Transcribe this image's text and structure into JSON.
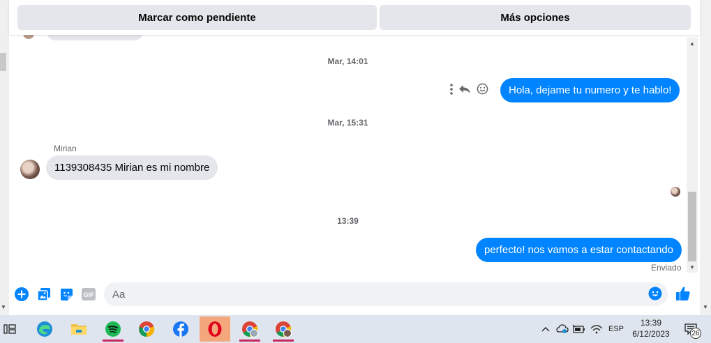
{
  "header": {
    "mark_pending_label": "Marcar como pendiente",
    "more_options_label": "Más opciones"
  },
  "conversation": {
    "timestamp_1": "Mar, 14:01",
    "outgoing_1": "Hola, dejame tu numero y te hablo!",
    "timestamp_2": "Mar, 15:31",
    "sender_name": "Mirian",
    "incoming_1": "1139308435 Mirian es mi nombre",
    "timestamp_3": "13:39",
    "outgoing_2": "perfecto! nos vamos a estar contactando",
    "status": "Enviado"
  },
  "composer": {
    "placeholder": "Aa",
    "gif_label": "GIF"
  },
  "taskbar": {
    "apps": [
      "task-view",
      "edge",
      "file-explorer",
      "spotify",
      "chrome",
      "facebook",
      "opera",
      "chrome-profile-1",
      "chrome-profile-2"
    ],
    "language": "ESP",
    "time": "13:39",
    "date": "6/12/2023",
    "notification_count": "26"
  },
  "colors": {
    "messenger_blue": "#0084ff",
    "incoming_bubble": "#e4e6eb",
    "taskbar_bg": "#dfe5ee",
    "opera_active": "#f4a67c",
    "indicator": "#c8275e"
  }
}
